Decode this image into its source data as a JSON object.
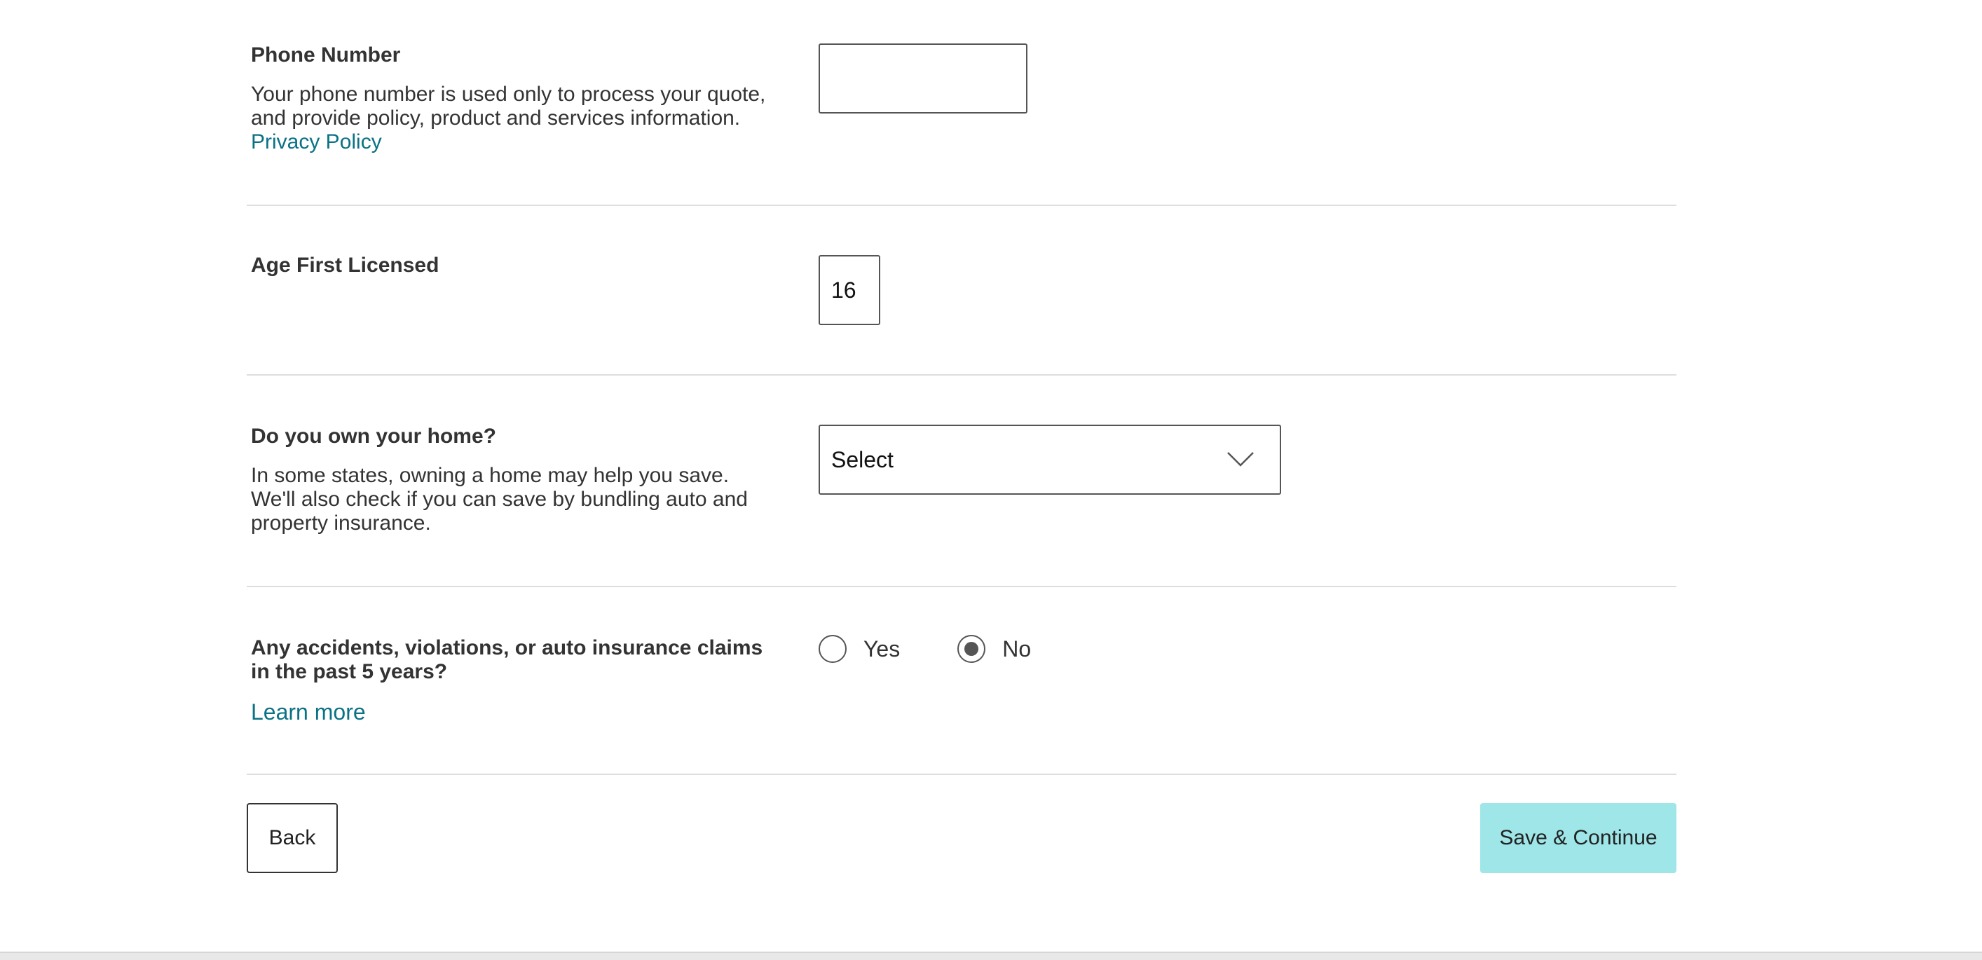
{
  "phone": {
    "title": "Phone Number",
    "description": "Your phone number is used only to process your quote, and provide policy, product and services information.",
    "privacy_link": "Privacy Policy",
    "value": ""
  },
  "age_licensed": {
    "title": "Age First Licensed",
    "value": "16"
  },
  "own_home": {
    "title": "Do you own your home?",
    "description": "In some states, owning a home may help you save. We'll also check if you can save by bundling auto and property insurance.",
    "selected": "Select"
  },
  "accidents": {
    "title": "Any accidents, violations, or auto insurance claims in the past 5 years?",
    "learn_more": "Learn more",
    "options": [
      {
        "label": "Yes",
        "checked": false
      },
      {
        "label": "No",
        "checked": true
      }
    ]
  },
  "buttons": {
    "back": "Back",
    "save_continue": "Save & Continue"
  },
  "colors": {
    "link": "#0b7285",
    "primary_button": "#9ee6e8",
    "divider": "#dedede"
  },
  "icons": {
    "select_arrow": "chevron-down-icon"
  }
}
